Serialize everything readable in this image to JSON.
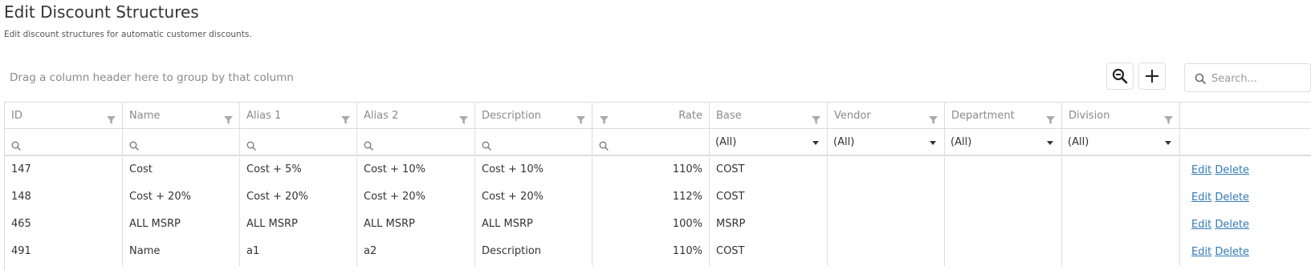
{
  "page": {
    "title": "Edit Discount Structures",
    "subtitle": "Edit discount structures for automatic customer discounts."
  },
  "toolbar": {
    "group_panel_text": "Drag a column header here to group by that column",
    "search_placeholder": "Search...",
    "zoom_icon": "zoom-out-icon",
    "add_icon": "plus-icon"
  },
  "columns": [
    {
      "label": "ID"
    },
    {
      "label": "Name"
    },
    {
      "label": "Alias 1"
    },
    {
      "label": "Alias 2"
    },
    {
      "label": "Description"
    },
    {
      "label": "Rate"
    },
    {
      "label": "Base"
    },
    {
      "label": "Vendor"
    },
    {
      "label": "Department"
    },
    {
      "label": "Division"
    },
    {
      "label": ""
    }
  ],
  "filters": {
    "base": "(All)",
    "vendor": "(All)",
    "department": "(All)",
    "division": "(All)"
  },
  "actions": {
    "edit": "Edit",
    "delete": "Delete"
  },
  "rows": [
    {
      "id": "147",
      "name": "Cost",
      "alias1": "Cost + 5%",
      "alias2": "Cost + 10%",
      "description": "Cost + 10%",
      "rate": "110%",
      "base": "COST",
      "vendor": "",
      "department": "",
      "division": ""
    },
    {
      "id": "148",
      "name": "Cost + 20%",
      "alias1": "Cost + 20%",
      "alias2": "Cost + 20%",
      "description": "Cost + 20%",
      "rate": "112%",
      "base": "COST",
      "vendor": "",
      "department": "",
      "division": ""
    },
    {
      "id": "465",
      "name": "ALL MSRP",
      "alias1": "ALL MSRP",
      "alias2": "ALL MSRP",
      "description": "ALL MSRP",
      "rate": "100%",
      "base": "MSRP",
      "vendor": "",
      "department": "",
      "division": ""
    },
    {
      "id": "491",
      "name": "Name",
      "alias1": "a1",
      "alias2": "a2",
      "description": "Description",
      "rate": "110%",
      "base": "COST",
      "vendor": "",
      "department": "",
      "division": ""
    }
  ],
  "colors": {
    "link": "#337ab7",
    "border": "#dddddd",
    "muted": "#8a8a8a"
  }
}
